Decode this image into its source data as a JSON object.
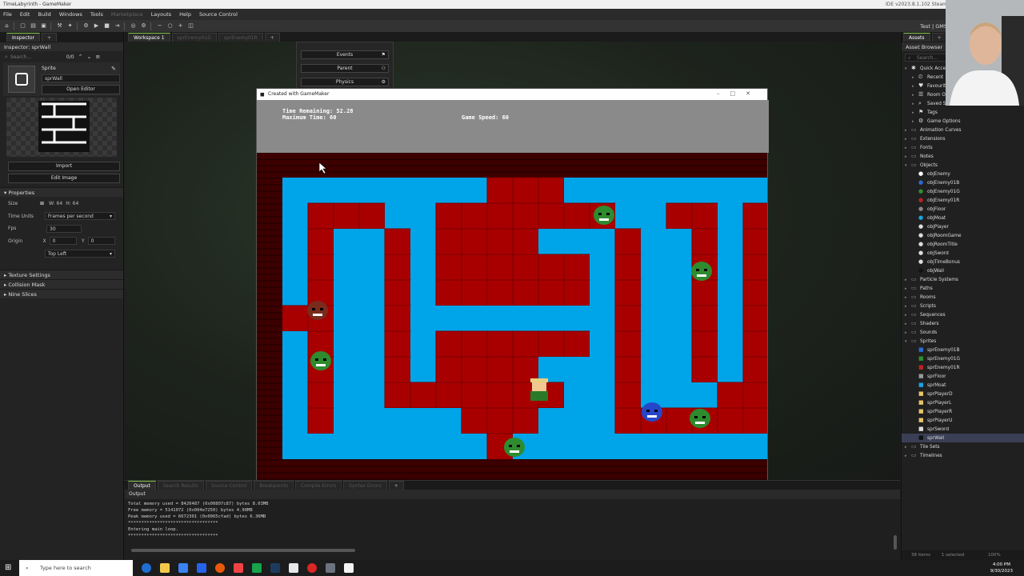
{
  "window": {
    "title": "TimeLabyrinth - GameMaker",
    "ide_version": "IDE v2023.8.1.102 Steam"
  },
  "menu": [
    "File",
    "Edit",
    "Build",
    "Windows",
    "Tools",
    "Marketplace",
    "Layouts",
    "Help",
    "Source Control"
  ],
  "toolbar": {
    "user": "Test | GMS"
  },
  "inspector": {
    "tab": "Inspector",
    "heading": "Inspector: sprWall",
    "search_placeholder": "Search...",
    "count": "0/0",
    "kind": "Sprite",
    "name": "sprWall",
    "open_editor": "Open Editor",
    "import": "Import",
    "edit_image": "Edit Image",
    "properties": "Properties",
    "size_label": "Size",
    "width": "W: 64",
    "height": "H: 64",
    "time_units_label": "Time Units",
    "time_units": "Frames per second",
    "fps_label": "Fps",
    "fps": "30",
    "origin_label": "Origin",
    "origin_x_label": "X",
    "origin_x": "0",
    "origin_y_label": "Y",
    "origin_y": "0",
    "origin_preset": "Top Left",
    "sections": [
      "Texture Settings",
      "Collision Mask",
      "Nine Slices"
    ]
  },
  "workspace": {
    "tabs": [
      "Workspace 1",
      "sprEnemy01G",
      "sprEnemy01R"
    ],
    "object_buttons": [
      "Events",
      "Parent",
      "Physics"
    ]
  },
  "game": {
    "window_title": "Created with GameMaker",
    "time_remaining": "Time Remaining: 52.28",
    "max_time": "Maximum Time: 60",
    "game_speed": "Game Speed: 60",
    "colors": {
      "wall": "#a80000",
      "floor": "#00a4e8",
      "border": "#3c0000",
      "hud": "#8a8a8a"
    }
  },
  "output": {
    "tabs": [
      "Output",
      "Search Results",
      "Source Control",
      "Breakpoints",
      "Compile Errors",
      "Syntax Errors"
    ],
    "header": "Output",
    "lines": [
      "Total memory used = 8420487 (0x00807c87) bytes 8.03MB",
      "Free memory = 5141072 (0x004e7250) bytes 4.90MB",
      "Peak memory used = 6672301 (0x0065cfad) bytes 6.36MB",
      "**********************************",
      "Entering main loop.",
      "**********************************"
    ]
  },
  "assets": {
    "tab": "Assets",
    "heading": "Asset Browser",
    "search_placeholder": "Search...",
    "quick_access": {
      "label": "Quick Access",
      "items": [
        "Recent",
        "Favourites",
        "Room Order",
        "Saved Searches",
        "Tags",
        "Game Options"
      ]
    },
    "folders_top": [
      "Animation Curves",
      "Extensions",
      "Fonts",
      "Notes"
    ],
    "objects": {
      "label": "Objects",
      "items": [
        "objEnemy",
        "objEnemy01B",
        "objEnemy01G",
        "objEnemy01R",
        "objFloor",
        "objMoat",
        "objPlayer",
        "objRoomGame",
        "objRoomTitle",
        "objSword",
        "objTimeBonus",
        "objWall"
      ]
    },
    "folders_mid": [
      "Particle Systems",
      "Paths",
      "Rooms",
      "Scripts",
      "Sequences",
      "Shaders",
      "Sounds"
    ],
    "sprites": {
      "label": "Sprites",
      "items": [
        "sprEnemy01B",
        "sprEnemy01G",
        "sprEnemy01R",
        "sprFloor",
        "sprMoat",
        "sprPlayerD",
        "sprPlayerL",
        "sprPlayerR",
        "sprPlayerU",
        "sprSword",
        "sprWall"
      ],
      "selected": "sprWall"
    },
    "folders_bottom": [
      "Tile Sets",
      "Timelines"
    ],
    "footer_count": "38 items",
    "footer_selected": "1 selected",
    "zoom": "100%"
  },
  "taskbar": {
    "search_placeholder": "Type here to search",
    "time": "4:00 PM",
    "date": "9/30/2023"
  }
}
